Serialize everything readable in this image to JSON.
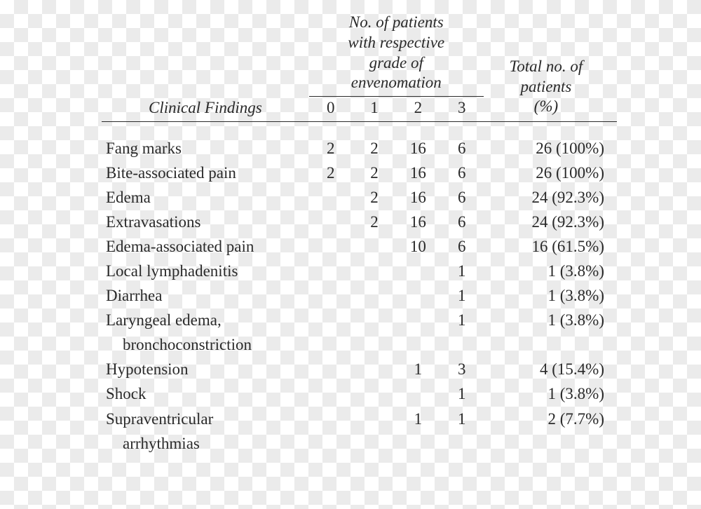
{
  "headers": {
    "clinical": "Clinical Findings",
    "grade_group": "No. of patients\nwith respective\ngrade of\nenvenomation",
    "grades": [
      "0",
      "1",
      "2",
      "3"
    ],
    "total": "Total no. of\npatients\n(%)"
  },
  "rows": [
    {
      "label": "Fang marks",
      "g0": "2",
      "g1": "2",
      "g2": "16",
      "g3": "6",
      "total": "26 (100%)"
    },
    {
      "label": "Bite-associated pain",
      "g0": "2",
      "g1": "2",
      "g2": "16",
      "g3": "6",
      "total": "26 (100%)"
    },
    {
      "label": "Edema",
      "g0": "",
      "g1": "2",
      "g2": "16",
      "g3": "6",
      "total": "24 (92.3%)"
    },
    {
      "label": "Extravasations",
      "g0": "",
      "g1": "2",
      "g2": "16",
      "g3": "6",
      "total": "24 (92.3%)"
    },
    {
      "label": "Edema-associated pain",
      "g0": "",
      "g1": "",
      "g2": "10",
      "g3": "6",
      "total": "16 (61.5%)"
    },
    {
      "label": "Local lymphadenitis",
      "g0": "",
      "g1": "",
      "g2": "",
      "g3": "1",
      "total": "1 (3.8%)"
    },
    {
      "label": "Diarrhea",
      "g0": "",
      "g1": "",
      "g2": "",
      "g3": "1",
      "total": "1 (3.8%)"
    },
    {
      "label": "Laryngeal edema,",
      "g0": "",
      "g1": "",
      "g2": "",
      "g3": "1",
      "total": "1 (3.8%)"
    },
    {
      "label": "bronchoconstriction",
      "indent": true,
      "g0": "",
      "g1": "",
      "g2": "",
      "g3": "",
      "total": ""
    },
    {
      "label": "Hypotension",
      "g0": "",
      "g1": "",
      "g2": "1",
      "g3": "3",
      "total": "4 (15.4%)"
    },
    {
      "label": "Shock",
      "g0": "",
      "g1": "",
      "g2": "",
      "g3": "1",
      "total": "1 (3.8%)"
    },
    {
      "label": "Supraventricular",
      "g0": "",
      "g1": "",
      "g2": "1",
      "g3": "1",
      "total": "2 (7.7%)"
    },
    {
      "label": "arrhythmias",
      "indent": true,
      "g0": "",
      "g1": "",
      "g2": "",
      "g3": "",
      "total": ""
    }
  ],
  "chart_data": {
    "type": "table",
    "title": "",
    "columns": [
      "Clinical Findings",
      "Grade 0",
      "Grade 1",
      "Grade 2",
      "Grade 3",
      "Total no. of patients (%)"
    ],
    "rows": [
      [
        "Fang marks",
        2,
        2,
        16,
        6,
        "26 (100%)"
      ],
      [
        "Bite-associated pain",
        2,
        2,
        16,
        6,
        "26 (100%)"
      ],
      [
        "Edema",
        null,
        2,
        16,
        6,
        "24 (92.3%)"
      ],
      [
        "Extravasations",
        null,
        2,
        16,
        6,
        "24 (92.3%)"
      ],
      [
        "Edema-associated pain",
        null,
        null,
        10,
        6,
        "16 (61.5%)"
      ],
      [
        "Local lymphadenitis",
        null,
        null,
        null,
        1,
        "1 (3.8%)"
      ],
      [
        "Diarrhea",
        null,
        null,
        null,
        1,
        "1 (3.8%)"
      ],
      [
        "Laryngeal edema, bronchoconstriction",
        null,
        null,
        null,
        1,
        "1 (3.8%)"
      ],
      [
        "Hypotension",
        null,
        null,
        1,
        3,
        "4 (15.4%)"
      ],
      [
        "Shock",
        null,
        null,
        null,
        1,
        "1 (3.8%)"
      ],
      [
        "Supraventricular arrhythmias",
        null,
        null,
        1,
        1,
        "2 (7.7%)"
      ]
    ]
  }
}
